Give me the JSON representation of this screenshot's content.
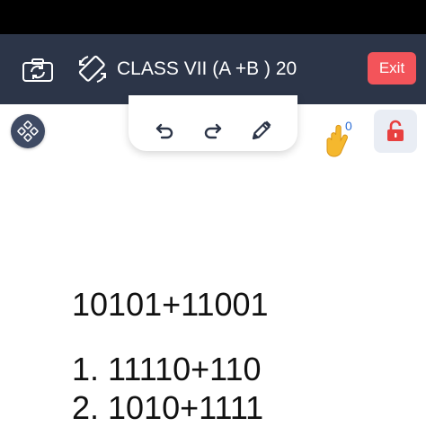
{
  "header": {
    "class_title": "CLASS VII (A +B ) 20",
    "exit_label": "Exit",
    "icons": {
      "camera": "camera-switch-icon",
      "rotate": "screen-rotate-icon"
    }
  },
  "toolbar": {
    "icons": [
      "undo-icon",
      "redo-icon",
      "pencil-icon"
    ]
  },
  "side_controls": {
    "tools_icon": "move-tools-icon",
    "raise_hand_icon": "raised-hand-icon",
    "raise_hand_count": "0",
    "lock_icon": "unlocked-padlock-icon"
  },
  "board": {
    "problem": "10101+11001",
    "items": [
      "1. 11110+110",
      "2. 1010+1111"
    ]
  },
  "colors": {
    "header_bg": "#2c3548",
    "exit_bg": "#f3545a",
    "lock_red": "#e8403f",
    "hand_yellow": "#f5b82e"
  }
}
